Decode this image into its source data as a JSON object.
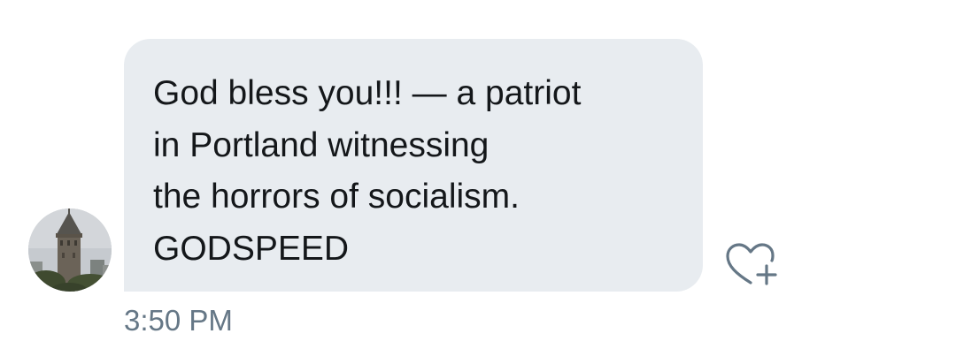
{
  "message": {
    "lines": [
      "God bless you!!! — a patriot",
      "in Portland witnessing",
      "the horrors of socialism.",
      "GODSPEED"
    ],
    "timestamp": "3:50 PM"
  },
  "icons": {
    "avatar": "profile-photo-tower",
    "like": "heart-plus-icon"
  },
  "colors": {
    "bubble_background": "#e8ecf0",
    "message_text": "#14171a",
    "timestamp_text": "#657786",
    "icon_stroke": "#657786"
  }
}
